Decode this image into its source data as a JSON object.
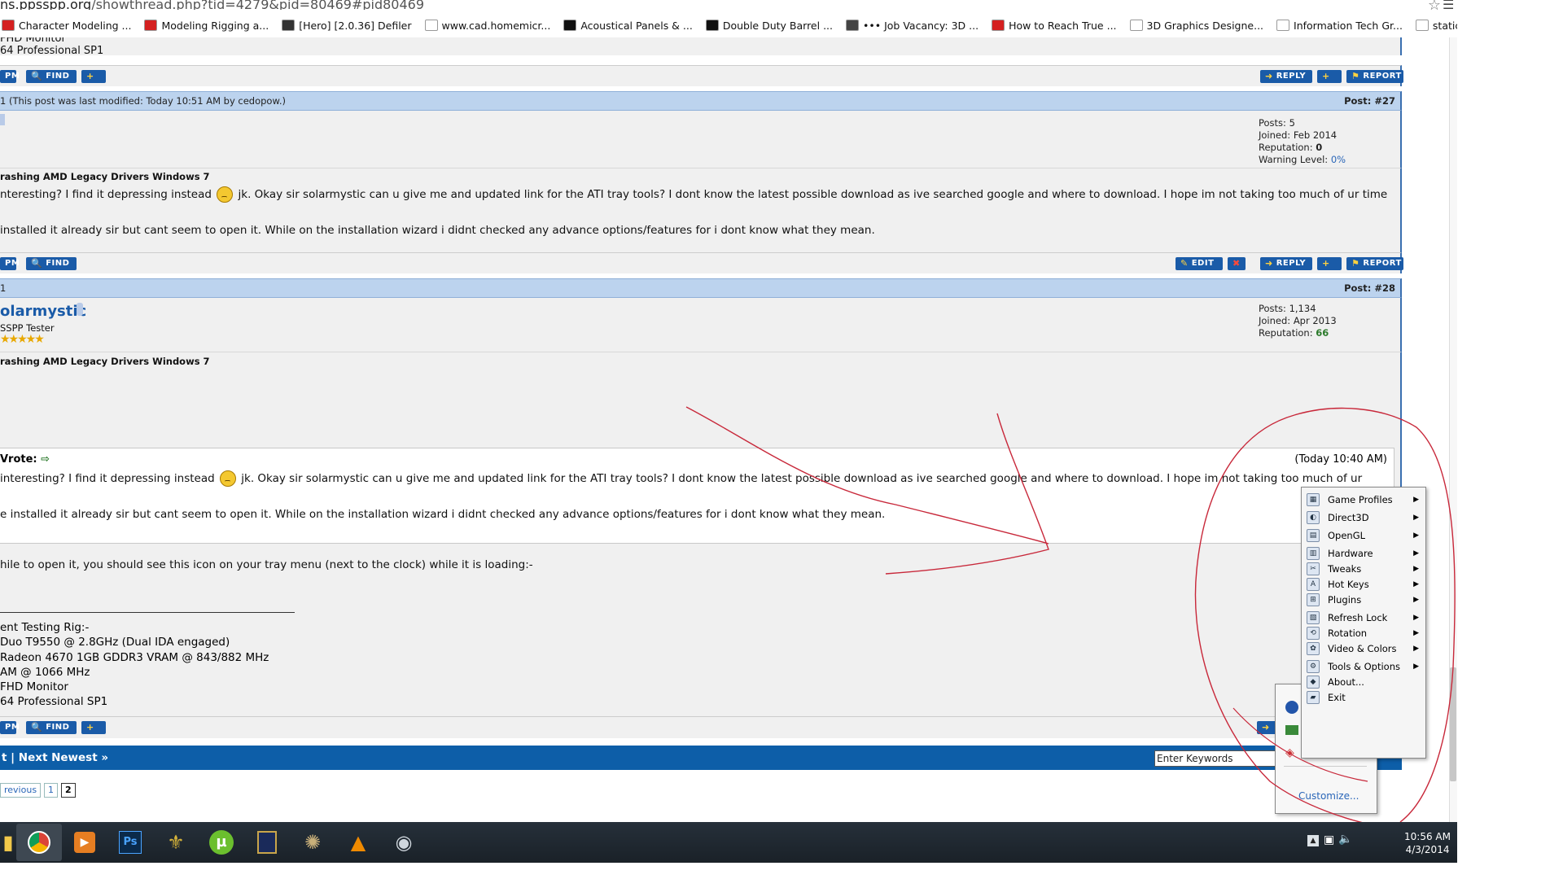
{
  "browser": {
    "url_prefix": "ns.ppsspp.org",
    "url_path": "/showthread.php?tid=4279&pid=80469#pid80469",
    "bookmarks": [
      {
        "label": "Character Modeling ...",
        "color": "#d42020"
      },
      {
        "label": "Modeling Rigging a...",
        "color": "#d42020"
      },
      {
        "label": "[Hero] [2.0.36] Defiler",
        "color": "#333333"
      },
      {
        "label": "www.cad.homemicr...",
        "color": "#ffffff"
      },
      {
        "label": "Acoustical Panels & ...",
        "color": "#111111"
      },
      {
        "label": "Double Duty Barrel ...",
        "color": "#111111"
      },
      {
        "label": "••• Job Vacancy: 3D ...",
        "color": "#444444"
      },
      {
        "label": "How to Reach True ...",
        "color": "#d42020"
      },
      {
        "label": "3D Graphics Designe...",
        "color": "#ffffff"
      },
      {
        "label": "Information Tech Gr...",
        "color": "#ffffff"
      },
      {
        "label": "static.nicic.gov/Libr...",
        "color": "#ffffff"
      }
    ],
    "more": "»"
  },
  "prev_post": {
    "sig_line1": "FHD Monitor",
    "sig_line2": "64 Professional SP1",
    "buttons_left": [
      "PM",
      "FIND"
    ],
    "buttons_right": [
      "REPLY",
      "REPORT"
    ]
  },
  "post27": {
    "head": "1 (This post was last modified: Today 10:51 AM by cedopow.)",
    "num": "Post: #27",
    "info": {
      "posts": "Posts: 5",
      "joined": "Joined: Feb 2014",
      "rep_label": "Reputation: ",
      "rep": "0",
      "warn_label": "Warning Level: ",
      "warn": "0%"
    },
    "subject": "rashing AMD Legacy Drivers Windows 7",
    "line1a": "nteresting? I find it depressing instead",
    "line1b": "jk. Okay sir solarmystic can u give me and updated link for the ATI tray tools? I dont know the latest possible download as ive searched google and where to download. I hope im not taking too much of ur time",
    "line2": " installed it already sir but cant seem to open it. While on the installation wizard i didnt checked any advance options/features for i dont know what they mean.",
    "buttons_left": [
      "PM",
      "FIND"
    ],
    "buttons_right": [
      "EDIT",
      "REPLY",
      "REPORT"
    ]
  },
  "post28": {
    "head": "1",
    "num": "Post: #28",
    "author": "olarmystic",
    "role": "SSPP Tester",
    "info": {
      "posts": "Posts: 1,134",
      "joined": "Joined: Apr 2013",
      "rep_label": "Reputation: ",
      "rep": "66"
    },
    "subject": "rashing AMD Legacy Drivers Windows 7",
    "wrote": "Vrote:",
    "quote_time": "(Today 10:40 AM)",
    "q1a": "interesting? I find it depressing instead",
    "q1b": "jk. Okay sir solarmystic can u give me and updated link for the ATI tray tools? I dont know the latest possible download as ive searched google and where to download. I hope im not taking too much of ur",
    "q2": "e installed it already sir but cant seem to open it. While on the installation wizard i didnt checked any advance options/features for i dont know what they mean.",
    "reply": "hile to open it, you should see this icon on your tray menu (next to the clock) while it is loading:-",
    "sig": [
      "ent Testing Rig:-",
      "Duo T9550 @ 2.8GHz (Dual IDA engaged)",
      "Radeon 4670 1GB GDDR3 VRAM @ 843/882 MHz",
      "AM @ 1066 MHz",
      "FHD Monitor",
      "64 Professional SP1"
    ],
    "buttons_left": [
      "PM",
      "FIND"
    ]
  },
  "nav": {
    "text": "t | Next Newest »",
    "keywords": "Enter Keywords"
  },
  "pager": {
    "prev": "revious",
    "p1": "1",
    "p2": "2"
  },
  "context_menu": [
    {
      "label": "Game Profiles",
      "u": "G",
      "icon": "game-profiles-icon",
      "sub": true
    },
    {
      "label": "Direct3D",
      "u": "D",
      "icon": "direct3d-icon",
      "sub": true
    },
    {
      "label": "OpenGL",
      "u": "O",
      "icon": "opengl-icon",
      "sub": true
    },
    {
      "label": "Hardware",
      "u": "H",
      "icon": "hardware-icon",
      "sub": true
    },
    {
      "label": "Tweaks",
      "u": "T",
      "icon": "tweaks-icon",
      "sub": true
    },
    {
      "label": "Hot Keys",
      "u": "K",
      "icon": "hotkeys-icon",
      "sub": true
    },
    {
      "label": "Plugins",
      "u": "P",
      "icon": "plugins-icon",
      "sub": true
    },
    {
      "label": "Refresh Lock",
      "u": "R",
      "icon": "refresh-lock-icon",
      "sub": true
    },
    {
      "label": "Rotation",
      "u": "R",
      "icon": "rotation-icon",
      "sub": true
    },
    {
      "label": "Video & Colors",
      "u": "V",
      "icon": "video-colors-icon",
      "sub": true
    },
    {
      "label": "Tools & Options",
      "u": "T",
      "icon": "tools-options-icon",
      "sub": true
    },
    {
      "label": "About...",
      "u": "A",
      "icon": "about-icon",
      "sub": false
    },
    {
      "label": "Exit",
      "u": "E",
      "icon": "exit-icon",
      "sub": false
    }
  ],
  "tray_overflow": {
    "customize": "Customize..."
  },
  "clock": {
    "time": "10:56 AM",
    "date": "4/3/2014"
  }
}
